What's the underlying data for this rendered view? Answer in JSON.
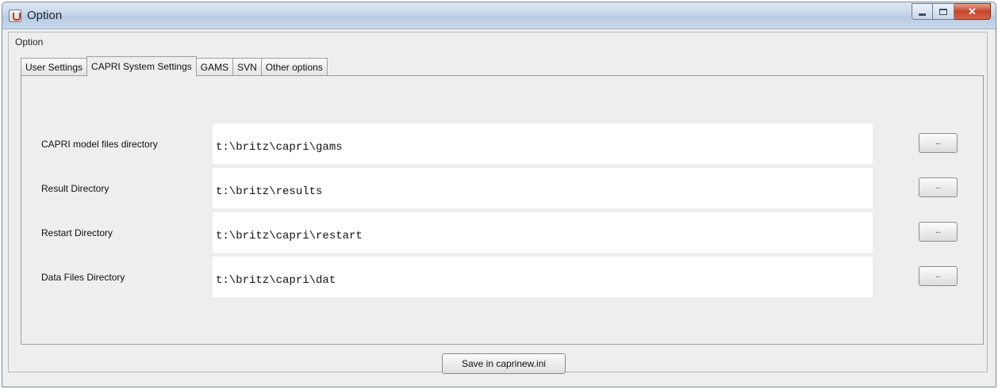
{
  "window": {
    "title": "Option"
  },
  "group": {
    "label": "Option"
  },
  "tabs": [
    {
      "label": "User Settings",
      "active": false
    },
    {
      "label": "CAPRI System Settings",
      "active": true
    },
    {
      "label": "GAMS",
      "active": false
    },
    {
      "label": "SVN",
      "active": false
    },
    {
      "label": "Other options",
      "active": false
    }
  ],
  "settings": {
    "rows": [
      {
        "label": "CAPRI model files directory",
        "value": "t:\\britz\\capri\\gams",
        "button": ".."
      },
      {
        "label": "Result Directory",
        "value": "t:\\britz\\results",
        "button": ".."
      },
      {
        "label": "Restart Directory",
        "value": "t:\\britz\\capri\\restart",
        "button": ".."
      },
      {
        "label": "Data Files Directory",
        "value": "t:\\britz\\capri\\dat",
        "button": ".."
      }
    ]
  },
  "footer": {
    "save_label": "Save in caprinew.ini"
  },
  "icons": {
    "app": "java-cup-icon",
    "minimize": "minimize-icon",
    "maximize": "maximize-icon",
    "close": "close-icon"
  },
  "colors": {
    "close_button": "#c5452a",
    "titlebar": "#c7d6e9",
    "panel": "#eeeeee"
  }
}
